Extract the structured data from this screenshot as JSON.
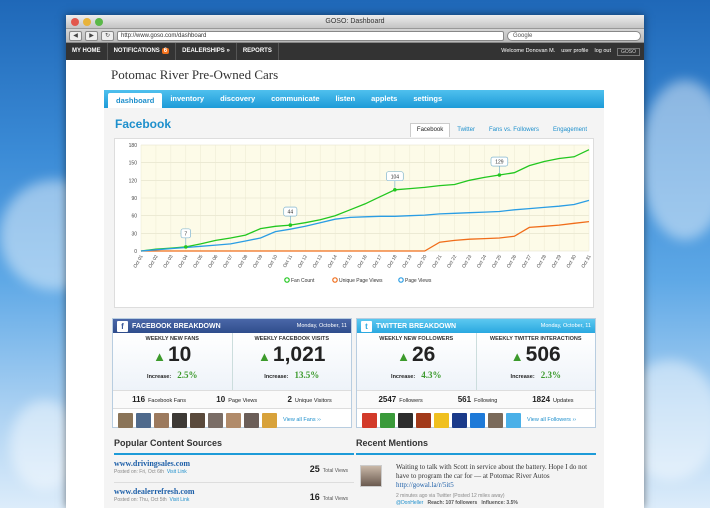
{
  "window": {
    "title": "GOSO: Dashboard",
    "url": "http://www.goso.com/dashboard",
    "search_placeholder": "Google"
  },
  "topnav": {
    "items": [
      "MY HOME",
      "NOTIFICATIONS",
      "DEALERSHIPS »",
      "REPORTS"
    ],
    "notifications_count": "6",
    "welcome": "Welcome Donovan M.",
    "user_profile": "user profile",
    "log_out": "log out",
    "logo": "GOSO"
  },
  "company": "Potomac River Pre-Owned Cars",
  "tabs": [
    "dashboard",
    "inventory",
    "discovery",
    "communicate",
    "listen",
    "applets",
    "settings"
  ],
  "section_title": "Facebook",
  "chart_tabs": [
    "Facebook",
    "Twitter",
    "Fans vs. Followers",
    "Engagement"
  ],
  "chart_data": {
    "type": "line",
    "x": [
      "Oct 01",
      "Oct 02",
      "Oct 03",
      "Oct 04",
      "Oct 05",
      "Oct 06",
      "Oct 07",
      "Oct 08",
      "Oct 09",
      "Oct 10",
      "Oct 11",
      "Oct 12",
      "Oct 13",
      "Oct 14",
      "Oct 15",
      "Oct 16",
      "Oct 17",
      "Oct 18",
      "Oct 19",
      "Oct 20",
      "Oct 21",
      "Oct 22",
      "Oct 23",
      "Oct 24",
      "Oct 25",
      "Oct 26",
      "Oct 27",
      "Oct 28",
      "Oct 29",
      "Oct 30",
      "Oct 31"
    ],
    "yticks": [
      0,
      30,
      60,
      90,
      120,
      150,
      180
    ],
    "ylim": [
      0,
      180
    ],
    "series": [
      {
        "name": "Fan Count",
        "color": "#22c71f",
        "values": [
          0,
          3,
          5,
          7,
          12,
          18,
          22,
          27,
          38,
          42,
          44,
          48,
          53,
          60,
          70,
          80,
          92,
          104,
          106,
          108,
          111,
          113,
          120,
          125,
          129,
          133,
          145,
          152,
          157,
          160,
          172
        ]
      },
      {
        "name": "Unique Page Views",
        "color": "#f06d1a",
        "values": [
          0,
          0,
          0,
          0,
          0,
          0,
          0,
          0,
          0,
          0,
          0,
          0,
          0,
          0,
          0,
          0,
          0,
          0,
          0,
          0,
          15,
          18,
          20,
          21,
          22,
          25,
          40,
          42,
          44,
          47,
          50
        ]
      },
      {
        "name": "Page Views",
        "color": "#2a9de4",
        "values": [
          0,
          2,
          4,
          6,
          8,
          10,
          12,
          17,
          22,
          33,
          37,
          42,
          48,
          54,
          57,
          58,
          59,
          59,
          60,
          61,
          63,
          64,
          65,
          66,
          67,
          70,
          72,
          74,
          76,
          79,
          86
        ]
      }
    ],
    "callouts": [
      {
        "x": "Oct 04",
        "series": "Fan Count",
        "label": "7"
      },
      {
        "x": "Oct 11",
        "series": "Fan Count",
        "label": "44"
      },
      {
        "x": "Oct 18",
        "series": "Fan Count",
        "label": "104"
      },
      {
        "x": "Oct 25",
        "series": "Fan Count",
        "label": "129"
      }
    ],
    "grid": true,
    "legend": "bottom"
  },
  "facebook": {
    "title": "FACEBOOK BREAKDOWN",
    "date": "Monday, October, 11",
    "stat1_label": "WEEKLY NEW FANS",
    "stat1_value": "10",
    "stat1_inc_label": "Increase:",
    "stat1_inc": "2.5%",
    "stat2_label": "WEEKLY FACEBOOK VISITS",
    "stat2_value": "1,021",
    "stat2_inc_label": "Increase:",
    "stat2_inc": "13.5%",
    "c1": "116",
    "c1_label": "Facebook Fans",
    "c2": "10",
    "c2_label": "Page Views",
    "c3": "2",
    "c3_label": "Unique Visitors",
    "view_all": "View all Fans ››"
  },
  "twitter": {
    "title": "TWITTER BREAKDOWN",
    "date": "Monday, October, 11",
    "stat1_label": "WEEKLY NEW FOLLOWERS",
    "stat1_value": "26",
    "stat1_inc_label": "Increase:",
    "stat1_inc": "4.3%",
    "stat2_label": "WEEKLY TWITTER INTERACTIONS",
    "stat2_value": "506",
    "stat2_inc_label": "Increase:",
    "stat2_inc": "2.3%",
    "c1": "2547",
    "c1_label": "Followers",
    "c2": "561",
    "c2_label": "Following",
    "c3": "1824",
    "c3_label": "Updates",
    "view_all": "View all Followers ››"
  },
  "popular": {
    "title": "Popular Content Sources",
    "rows": [
      {
        "site": "www.drivingsales.com",
        "posted": "Posted on: Fri, Oct 6th",
        "visit": "Visit Link",
        "views": "25",
        "views_label": "Total Views"
      },
      {
        "site": "www.dealerrefresh.com",
        "posted": "Posted on: Thu, Oct 5th",
        "visit": "Visit Link",
        "views": "16",
        "views_label": "Total Views"
      }
    ]
  },
  "mentions": {
    "title": "Recent Mentions",
    "text": "Waiting to talk with Scott in service about the battery. Hope I do not have to program the car for — at Potomac River Autos",
    "link": "http://gowal.la/r/5it5",
    "meta": "2 minutes ago via Twitter (Posted 12 miles away)",
    "user": "@DonHeller",
    "reach": "Reach: 107 followers",
    "influence": "Influence: 3.5%"
  }
}
